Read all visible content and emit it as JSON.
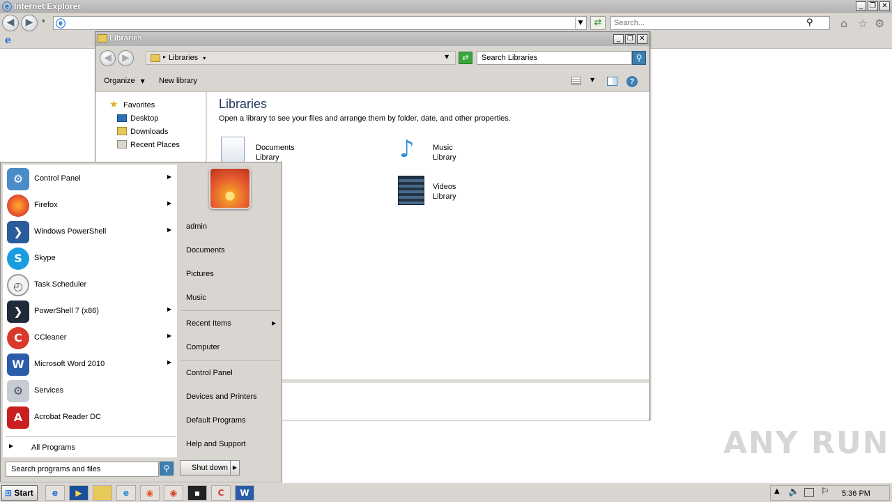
{
  "ie": {
    "title": "Internet Explorer",
    "search_placeholder": "Search...",
    "controls": {
      "minimize": "_",
      "maximize": "❐",
      "close": "✕"
    },
    "page_icon": "e"
  },
  "explorer": {
    "title": "Libraries",
    "breadcrumb": "Libraries",
    "search_placeholder": "Search Libraries",
    "toolbar": {
      "organize": "Organize",
      "new_library": "New library"
    },
    "nav": {
      "favorites": "Favorites",
      "items": [
        "Desktop",
        "Downloads",
        "Recent Places"
      ]
    },
    "content": {
      "title": "Libraries",
      "description": "Open a library to see your files and arrange them by folder, date, and other properties.",
      "libraries": [
        {
          "name": "Documents",
          "sub": "Library",
          "icon": "documents-library-icon"
        },
        {
          "name": "Music",
          "sub": "Library",
          "icon": "music-library-icon"
        },
        {
          "name": "Videos",
          "sub": "Library",
          "icon": "videos-library-icon"
        }
      ]
    }
  },
  "start_menu": {
    "programs": [
      {
        "label": "Control Panel",
        "icon": "control-panel-icon",
        "submenu": true
      },
      {
        "label": "Firefox",
        "icon": "firefox-icon",
        "submenu": true
      },
      {
        "label": "Windows PowerShell",
        "icon": "powershell-icon",
        "submenu": true
      },
      {
        "label": "Skype",
        "icon": "skype-icon",
        "submenu": false
      },
      {
        "label": "Task Scheduler",
        "icon": "task-scheduler-icon",
        "submenu": false
      },
      {
        "label": "PowerShell 7 (x86)",
        "icon": "powershell7-icon",
        "submenu": true
      },
      {
        "label": "CCleaner",
        "icon": "ccleaner-icon",
        "submenu": true
      },
      {
        "label": "Microsoft Word 2010",
        "icon": "word-icon",
        "submenu": true
      },
      {
        "label": "Services",
        "icon": "services-icon",
        "submenu": false
      },
      {
        "label": "Acrobat Reader DC",
        "icon": "acrobat-icon",
        "submenu": false
      }
    ],
    "all_programs": "All Programs",
    "search_placeholder": "Search programs and files",
    "right_items": {
      "user": "admin",
      "documents": "Documents",
      "pictures": "Pictures",
      "music": "Music",
      "recent_items": "Recent Items",
      "computer": "Computer",
      "control_panel": "Control Panel",
      "devices": "Devices and Printers",
      "default_programs": "Default Programs",
      "help": "Help and Support"
    },
    "shutdown": "Shut down"
  },
  "taskbar": {
    "start_label": "Start",
    "pinned": [
      "internet-explorer-icon",
      "media-player-icon",
      "explorer-folder-icon",
      "edge-icon",
      "firefox-icon",
      "chrome-icon",
      "terminal-icon",
      "ccleaner-icon",
      "word-icon"
    ],
    "clock": "5:36 PM"
  },
  "watermark": "ANY RUN",
  "colors": {
    "title_blue": "#1e395b",
    "accent": "#3c7fb1",
    "chrome": "#d9d5d0"
  }
}
